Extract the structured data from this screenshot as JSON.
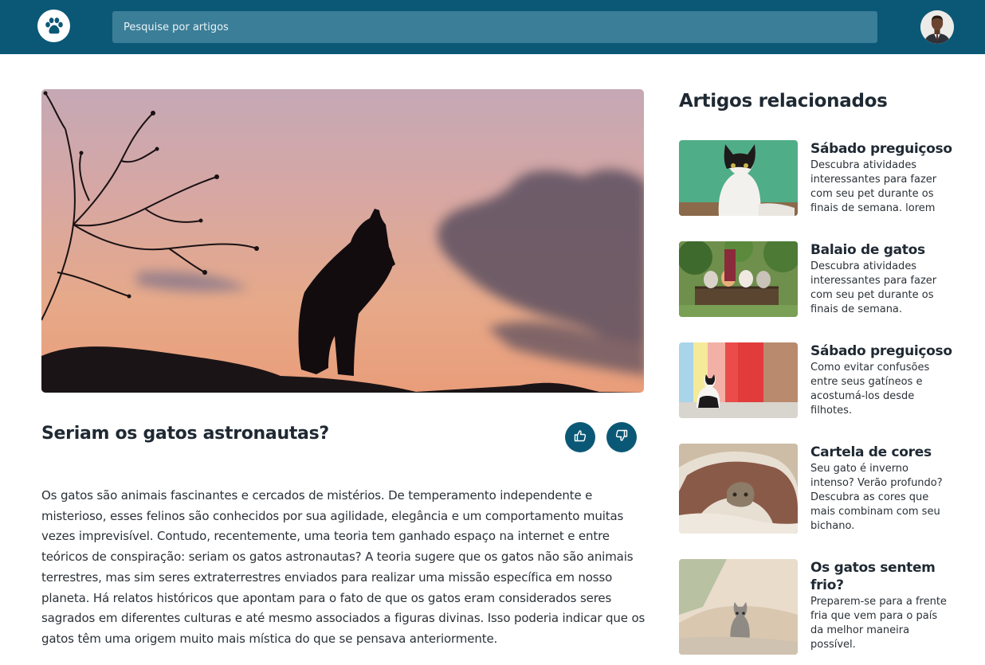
{
  "header": {
    "search_placeholder": "Pesquise por artigos",
    "logo_icon": "paw-icon",
    "avatar_icon": "user-avatar"
  },
  "article": {
    "title": "Seriam os gatos astronautas?",
    "body": "Os gatos são animais fascinantes e cercados de mistérios. De temperamento independente e misterioso, esses felinos são conhecidos por sua agilidade, elegância e um comportamento muitas vezes imprevisível. Contudo, recentemente, uma teoria tem ganhado espaço na internet e entre teóricos de conspiração: seriam os gatos astronautas? A teoria sugere que os gatos não são animais terrestres, mas sim seres extraterrestres enviados para realizar uma missão específica em nosso planeta. Há relatos históricos que apontam para o fato de que os gatos eram considerados seres sagrados em diferentes culturas e até mesmo associados a figuras divinas. Isso poderia indicar que os gatos têm uma origem muito mais mística do que se pensava anteriormente.",
    "like_icon": "thumbs-up-icon",
    "dislike_icon": "thumbs-down-icon"
  },
  "related": {
    "title": "Artigos relacionados",
    "items": [
      {
        "title": "Sábado preguiçoso",
        "description": "Descubra atividades interessantes para fazer com seu pet durante os finais de semana. lorem"
      },
      {
        "title": "Balaio de gatos",
        "description": "Descubra atividades interessantes para fazer com seu pet durante os finais de semana."
      },
      {
        "title": "Sábado preguiçoso",
        "description": "Como evitar confusões entre seus gatíneos e acostumá-los desde filhotes."
      },
      {
        "title": "Cartela de cores",
        "description": "Seu gato é inverno intenso? Verão profundo? Descubra as cores que mais combinam com seu bichano."
      },
      {
        "title": "Os gatos sentem frio?",
        "description": "Preparem-se para a frente fria que vem para o país da melhor maneira possível."
      }
    ]
  },
  "colors": {
    "primary": "#0b5876",
    "search_bg": "#3b7e98"
  }
}
